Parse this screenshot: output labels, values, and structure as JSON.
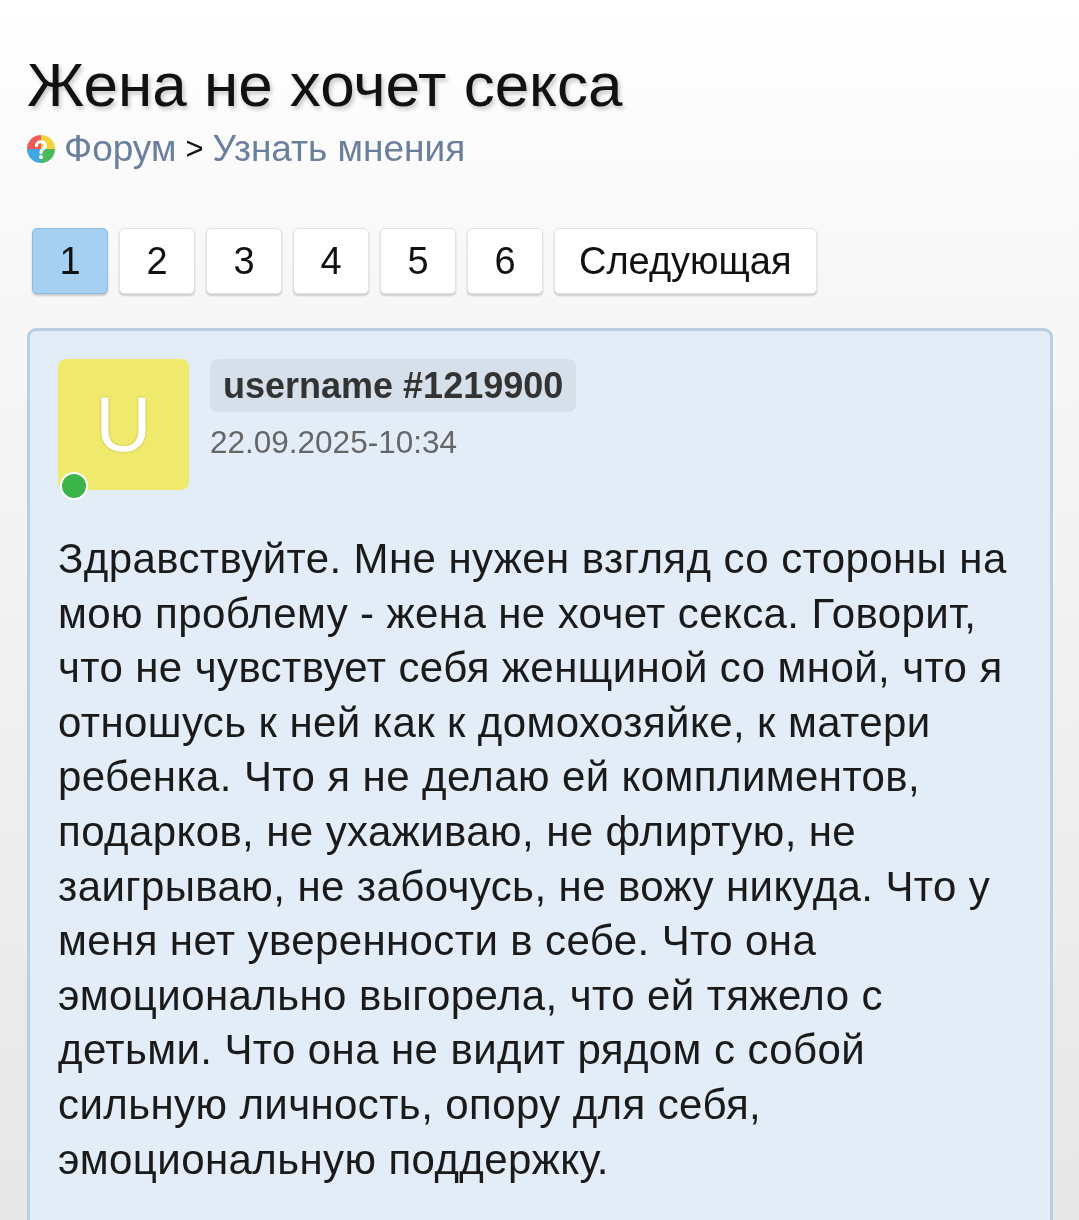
{
  "page": {
    "title": "Жена не хочет секса"
  },
  "breadcrumb": [
    {
      "kind": "link",
      "text": "Форум"
    },
    {
      "kind": "separator",
      "text": ">"
    },
    {
      "kind": "link",
      "text": "Узнать мнения"
    }
  ],
  "pagination": [
    {
      "label": "1",
      "selected": true
    },
    {
      "label": "2",
      "selected": false
    },
    {
      "label": "3",
      "selected": false
    },
    {
      "label": "4",
      "selected": false
    },
    {
      "label": "5",
      "selected": false
    },
    {
      "label": "6",
      "selected": false
    },
    {
      "label": "Следующая",
      "selected": false
    }
  ],
  "post": {
    "author": {
      "name": "username #1219900",
      "avatar_letter": "U",
      "online": true
    },
    "date": "22.09.2025-10:34",
    "text": "Здравствуйте. Мне нужен взгляд со стороны на мою проблему - жена не хочет секса. Говорит, что не чувствует себя женщиной со мной, что я отношусь к ней как к домохозяйке, к матери ребенка. Что я не делаю ей комплиментов, подарков, не ухаживаю, не флиртую, не заигрываю, не забочусь, не вожу никуда. Что у меня нет уверенности в себе. Что она эмоционально выгорела, что ей тяжело с детьми. Что она не видит рядом с собой сильную личность, опору для себя, эмоциональную поддержку."
  }
}
